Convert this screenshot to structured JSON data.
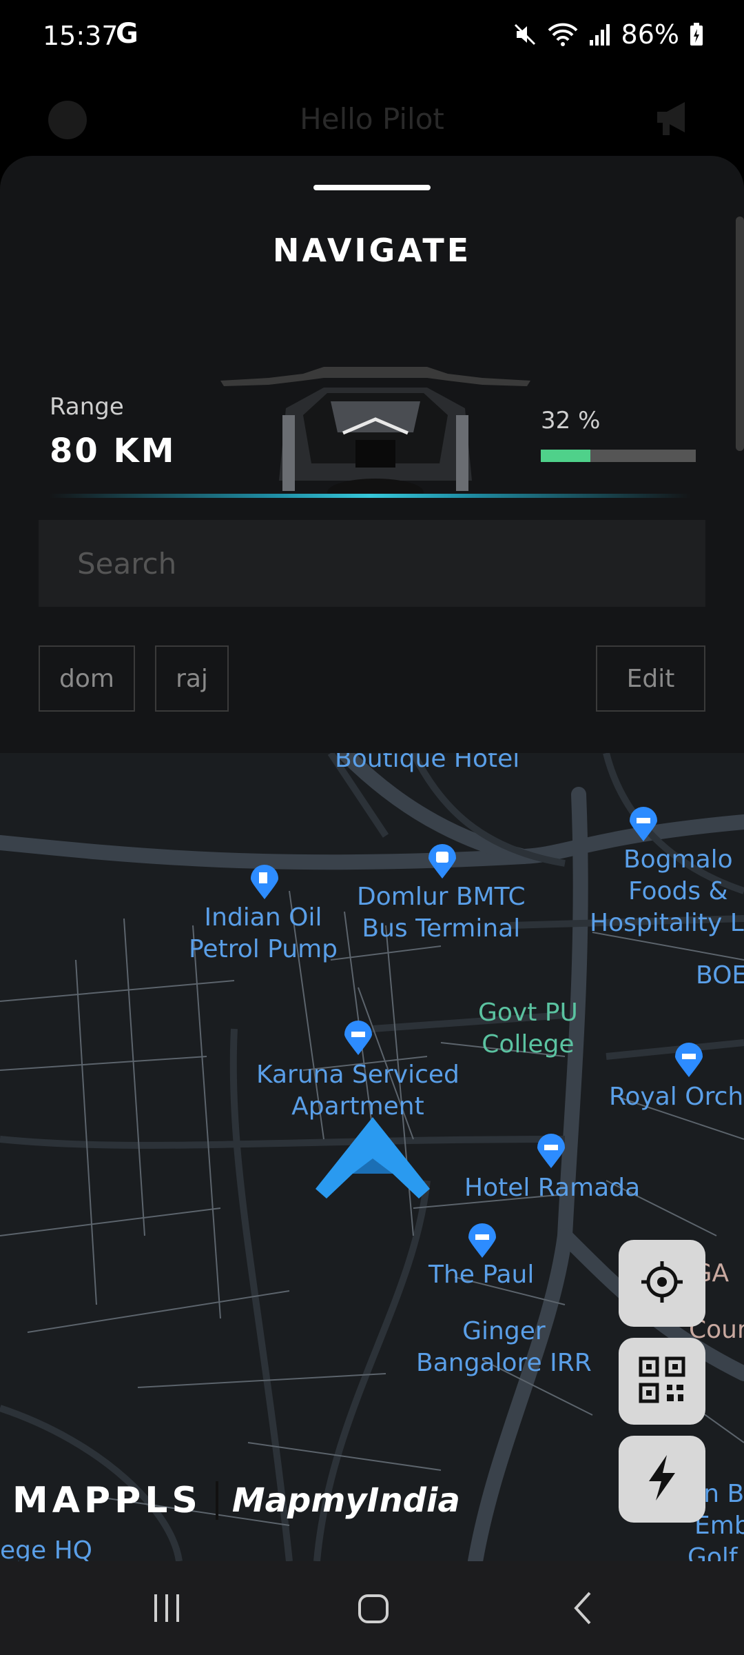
{
  "status_bar": {
    "time": "15:37",
    "g_label": "G",
    "battery": "86%"
  },
  "background_header": {
    "greeting": "Hello Pilot"
  },
  "sheet": {
    "title": "NAVIGATE",
    "range_label": "Range",
    "range_value": "80 KM",
    "battery_percent_text": "32 %",
    "battery_level": 0.32,
    "search_placeholder": "Search",
    "saved_places": [
      "dom",
      "raj"
    ],
    "edit_label": "Edit"
  },
  "map": {
    "pois": {
      "boutique": "Boutique Hotel",
      "bogmalo_1": "Bogmalo",
      "bogmalo_2": "Foods &",
      "bogmalo_3": "Hospitality Llp",
      "boe": "BOE",
      "indian_oil_1": "Indian Oil",
      "indian_oil_2": "Petrol Pump",
      "domlur_1": "Domlur BMTC",
      "domlur_2": "Bus Terminal",
      "govt_1": "Govt PU",
      "govt_2": "College",
      "karuna_1": "Karuna Serviced",
      "karuna_2": "Apartment",
      "royal": "Royal Orch",
      "ramada": "Hotel Ramada",
      "paul": "The Paul",
      "ginger_1": "Ginger",
      "ginger_2": "Bangalore IRR",
      "kga_1": "KGA G",
      "kga_2": "Cour",
      "hilton_1": "Hilton B",
      "hilton_2": "Emb",
      "hilton_3": "Golf",
      "ege": "ege HQ"
    },
    "attribution_brand": "MAPPLS",
    "attribution_partner": "MapmyIndia"
  }
}
